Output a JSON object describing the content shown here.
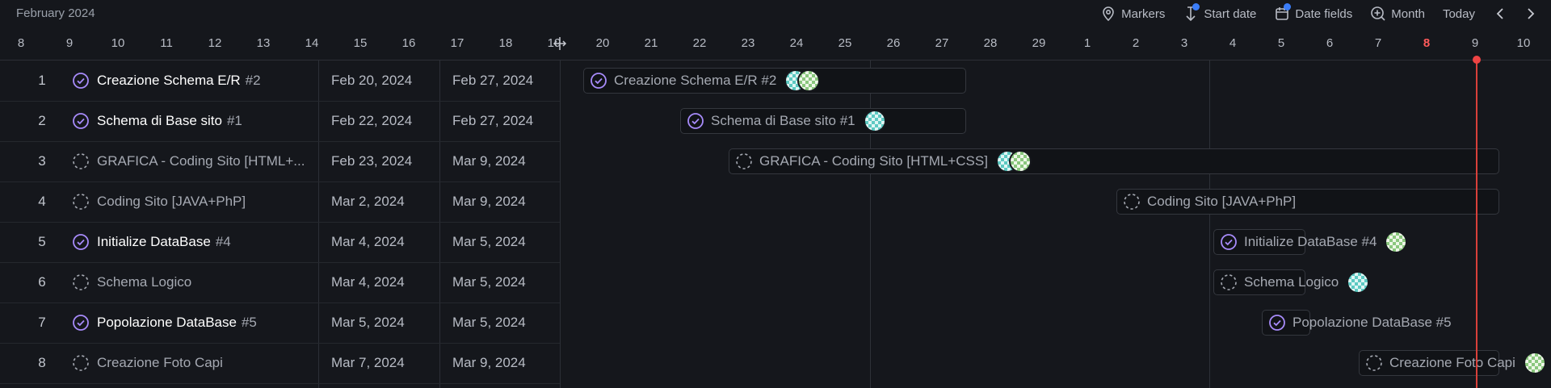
{
  "header": {
    "month": "February 2024",
    "toolbar": {
      "markers": "Markers",
      "start_date": "Start date",
      "date_fields": "Date fields",
      "month": "Month",
      "today": "Today"
    }
  },
  "ruler": {
    "days": [
      "8",
      "9",
      "10",
      "11",
      "12",
      "13",
      "14",
      "15",
      "16",
      "17",
      "18",
      "19",
      "20",
      "21",
      "22",
      "23",
      "24",
      "25",
      "26",
      "27",
      "28",
      "29",
      "1",
      "2",
      "3",
      "4",
      "5",
      "6",
      "7",
      "8",
      "9",
      "10"
    ],
    "today_label": "9"
  },
  "tasks": [
    {
      "num": "1",
      "title": "Creazione Schema E/R",
      "ref": "#2",
      "done": true,
      "start": "Feb 20, 2024",
      "end": "Feb 27, 2024",
      "bar_label": "Creazione Schema E/R #2"
    },
    {
      "num": "2",
      "title": "Schema di Base sito",
      "ref": "#1",
      "done": true,
      "start": "Feb 22, 2024",
      "end": "Feb 27, 2024",
      "bar_label": "Schema di Base sito #1"
    },
    {
      "num": "3",
      "title": "GRAFICA - Coding Sito [HTML+...",
      "ref": "",
      "done": false,
      "start": "Feb 23, 2024",
      "end": "Mar 9, 2024",
      "bar_label": "GRAFICA - Coding Sito [HTML+CSS]"
    },
    {
      "num": "4",
      "title": "Coding Sito [JAVA+PhP]",
      "ref": "",
      "done": false,
      "start": "Mar 2, 2024",
      "end": "Mar 9, 2024",
      "bar_label": "Coding Sito [JAVA+PhP]"
    },
    {
      "num": "5",
      "title": "Initialize DataBase",
      "ref": "#4",
      "done": true,
      "start": "Mar 4, 2024",
      "end": "Mar 5, 2024",
      "bar_label": "Initialize DataBase #4"
    },
    {
      "num": "6",
      "title": "Schema Logico",
      "ref": "",
      "done": false,
      "start": "Mar 4, 2024",
      "end": "Mar 5, 2024",
      "bar_label": "Schema Logico"
    },
    {
      "num": "7",
      "title": "Popolazione DataBase",
      "ref": "#5",
      "done": true,
      "start": "Mar 5, 2024",
      "end": "Mar 5, 2024",
      "bar_label": "Popolazione DataBase #5"
    },
    {
      "num": "8",
      "title": "Creazione Foto Capi",
      "ref": "",
      "done": false,
      "start": "Mar 7, 2024",
      "end": "Mar 9, 2024",
      "bar_label": "Creazione Foto Capi"
    }
  ],
  "colors": {
    "done_check": "#a78bfa",
    "today": "#ef4444",
    "badge": "#3b7df8"
  }
}
